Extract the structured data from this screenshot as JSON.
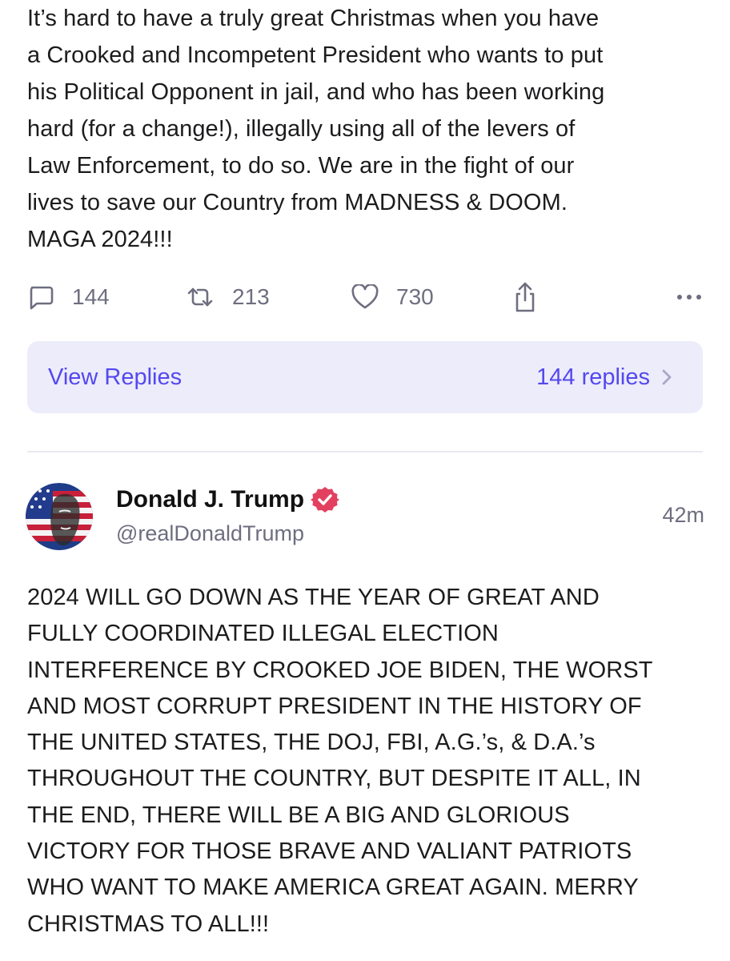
{
  "post1": {
    "text": "It’s hard to have a truly great Christmas when you have\na Crooked and Incompetent President who wants to put\nhis Political Opponent in jail, and who has been working\nhard (for a change!), illegally using all of the levers of\nLaw Enforcement, to do so. We are in the fight of our\nlives to save our Country from MADNESS & DOOM.\nMAGA 2024!!!",
    "actions": {
      "reply_count": "144",
      "retruth_count": "213",
      "like_count": "730"
    },
    "icons": [
      "reply-icon",
      "retruth-icon",
      "heart-icon",
      "share-icon",
      "more-icon",
      "chevron-right-icon"
    ],
    "replies_bar": {
      "view_label": "View Replies",
      "count_label": "144 replies"
    }
  },
  "post2": {
    "author_name": "Donald J. Trump",
    "handle": "@realDonaldTrump",
    "time": "42m",
    "text": "2024 WILL GO DOWN AS THE YEAR OF GREAT AND\nFULLY COORDINATED ILLEGAL ELECTION\nINTERFERENCE BY CROOKED JOE BIDEN, THE WORST\nAND MOST CORRUPT PRESIDENT IN THE HISTORY OF\nTHE UNITED STATES, THE DOJ, FBI, A.G.’s, & D.A.’s\nTHROUGHOUT THE COUNTRY, BUT DESPITE IT ALL, IN\nTHE END, THERE WILL BE A BIG AND GLORIOUS\nVICTORY FOR THOSE BRAVE AND VALIANT PATRIOTS\nWHO WANT TO MAKE AMERICA GREAT AGAIN. MERRY\nCHRISTMAS TO ALL!!!"
  },
  "colors": {
    "accent": "#5448ee",
    "replies_bg": "#ececfb",
    "muted": "#6e6e80",
    "verified": "#e3405f",
    "divider": "#e9e9ee"
  }
}
